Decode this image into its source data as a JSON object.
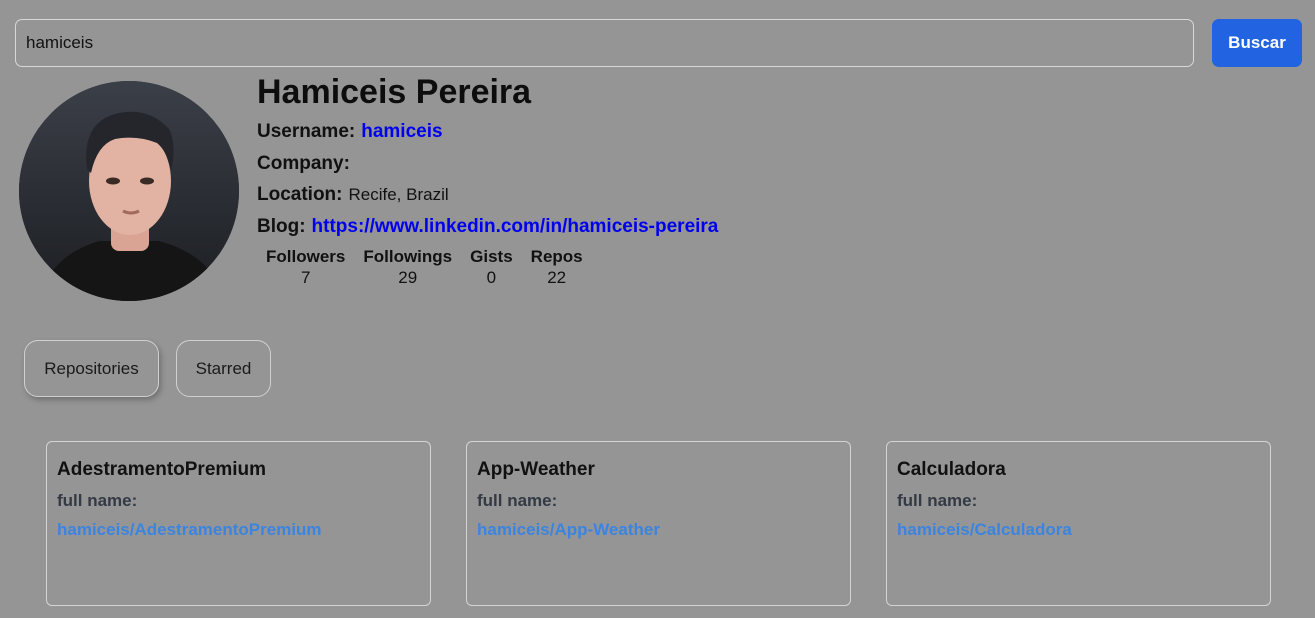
{
  "search": {
    "value": "hamiceis",
    "button_label": "Buscar"
  },
  "profile": {
    "name": "Hamiceis Pereira",
    "username_label": "Username:",
    "username": "hamiceis",
    "company_label": "Company:",
    "company": "",
    "location_label": "Location:",
    "location": "Recife, Brazil",
    "blog_label": "Blog:",
    "blog": "https://www.linkedin.com/in/hamiceis-pereira"
  },
  "stats": [
    {
      "label": "Followers",
      "value": "7"
    },
    {
      "label": "Followings",
      "value": "29"
    },
    {
      "label": "Gists",
      "value": "0"
    },
    {
      "label": "Repos",
      "value": "22"
    }
  ],
  "tabs": [
    {
      "label": "Repositories"
    },
    {
      "label": "Starred"
    }
  ],
  "repos": [
    {
      "name": "AdestramentoPremium",
      "fullname_label": "full name:",
      "fullname": "hamiceis/AdestramentoPremium"
    },
    {
      "name": "App-Weather",
      "fullname_label": "full name:",
      "fullname": "hamiceis/App-Weather"
    },
    {
      "name": "Calculadora",
      "fullname_label": "full name:",
      "fullname": "hamiceis/Calculadora"
    }
  ]
}
